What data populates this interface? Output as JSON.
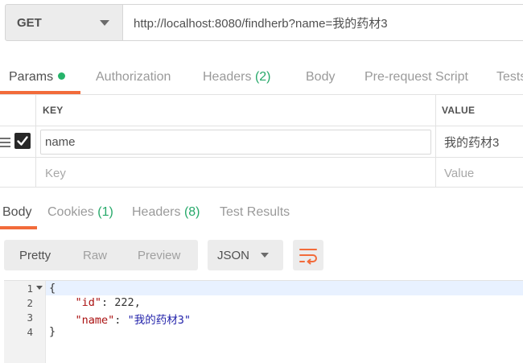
{
  "request": {
    "method": "GET",
    "url": "http://localhost:8080/findherb?name=我的药材3"
  },
  "request_tabs": [
    {
      "label": "Params",
      "count": ""
    },
    {
      "label": "Authorization",
      "count": ""
    },
    {
      "label": "Headers",
      "count": "(2)"
    },
    {
      "label": "Body",
      "count": ""
    },
    {
      "label": "Pre-request Script",
      "count": ""
    },
    {
      "label": "Tests",
      "count": ""
    }
  ],
  "params": {
    "headers": {
      "key": "KEY",
      "value": "VALUE"
    },
    "rows": [
      {
        "key": "name",
        "value": "我的药材3",
        "checked": true
      }
    ],
    "new_row": {
      "key_placeholder": "Key",
      "value_placeholder": "Value"
    }
  },
  "response_tabs": [
    {
      "label": "Body",
      "count": ""
    },
    {
      "label": "Cookies",
      "count": "(1)"
    },
    {
      "label": "Headers",
      "count": "(8)"
    },
    {
      "label": "Test Results",
      "count": ""
    }
  ],
  "view_modes": [
    "Pretty",
    "Raw",
    "Preview"
  ],
  "format": "JSON",
  "code": {
    "line_numbers": [
      "1",
      "2",
      "3",
      "4"
    ],
    "lines": {
      "l1": "{",
      "l2_key": "\"id\"",
      "l2_sep": ": ",
      "l2_val": "222",
      "l2_end": ",",
      "l3_key": "\"name\"",
      "l3_sep": ": ",
      "l3_val": "\"我的药材3\"",
      "l4": "}"
    }
  },
  "colors": {
    "accent": "#f26b3a",
    "count_green": "#26a96a",
    "status_dot": "#26b36a"
  }
}
